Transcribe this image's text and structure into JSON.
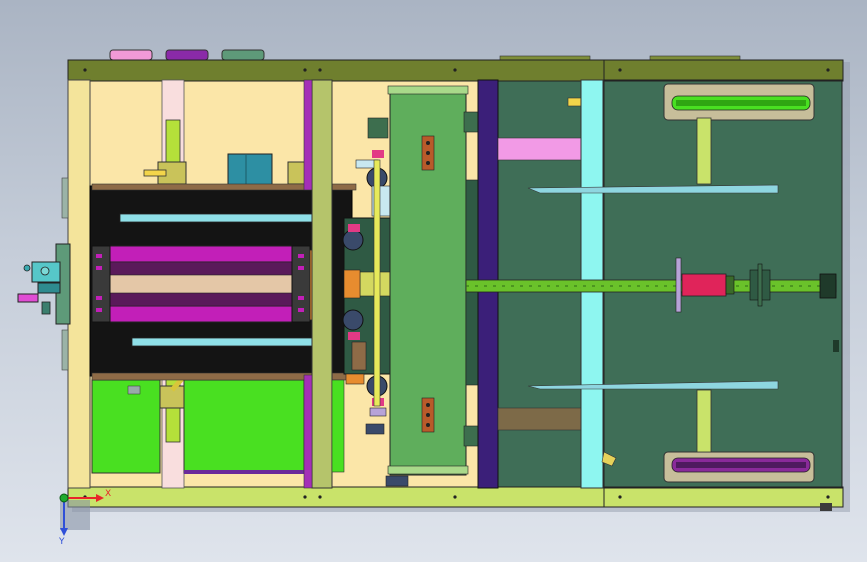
{
  "viewport": {
    "background_top": "#aab4c3",
    "background_bottom": "#dfe4ec"
  },
  "triad": {
    "x_label": "X",
    "y_label": "Y",
    "x_color": "#e8262a",
    "y_color": "#2f4fd8",
    "origin_color": "#1faa2d"
  },
  "palette": {
    "frame_olive": "#6f7f2e",
    "frame_lime": "#c9e36a",
    "cream": "#fbe6a8",
    "dark_green_plate": "#3f6e57",
    "black_core": "#141414",
    "magenta": "#c21fb8",
    "cyan_rail": "#8fe0e8",
    "bright_green": "#49e021",
    "navy_post": "#3b1f79"
  }
}
